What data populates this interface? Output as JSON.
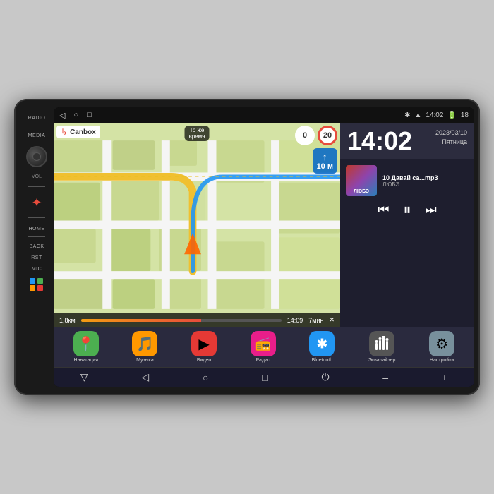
{
  "device": {
    "bg_color": "#c8c8c8"
  },
  "status_bar": {
    "nav_icons": [
      "◁",
      "○",
      "□"
    ],
    "bluetooth_icon": "⚡",
    "wifi_icon": "▲",
    "time": "14:02",
    "battery": "18"
  },
  "map": {
    "brand": "Canbox",
    "speed_current": "0",
    "speed_limit": "20",
    "turn_label": "То же",
    "turn_label2": "время",
    "distance": "10 м",
    "arrow": "↑",
    "bottom": {
      "distance_remaining": "1,8км",
      "eta_time": "14:09",
      "duration": "7мин"
    }
  },
  "clock": {
    "time": "14:02",
    "date": "2023/03/10",
    "day": "Пятница"
  },
  "music": {
    "track_number": "10",
    "title": "Давай са...mp3",
    "artist": "ЛЮБЭ",
    "album_label": "ЛЮБЭ"
  },
  "apps": [
    {
      "name": "Навигация",
      "icon": "📍",
      "bg": "#4CAF50"
    },
    {
      "name": "Музыка",
      "icon": "🎵",
      "bg": "#FF9800"
    },
    {
      "name": "Видео",
      "icon": "▶",
      "bg": "#E53935"
    },
    {
      "name": "Радио",
      "icon": "📻",
      "bg": "#F06292"
    },
    {
      "name": "Bluetooth",
      "icon": "⬡",
      "bg": "#2196F3"
    },
    {
      "name": "Эквалайзер",
      "icon": "⚡",
      "bg": "#555"
    },
    {
      "name": "Настройки",
      "icon": "⚙",
      "bg": "#78909C"
    }
  ],
  "side_controls": {
    "radio_label": "RADIO",
    "media_label": "MEDIA",
    "home_label": "HOME",
    "back_label": "BACK",
    "rst_label": "RST",
    "mic_label": "MIC"
  },
  "bottom_nav": [
    "▽",
    "◁",
    "○",
    "□",
    "⏻",
    "–",
    "+"
  ]
}
